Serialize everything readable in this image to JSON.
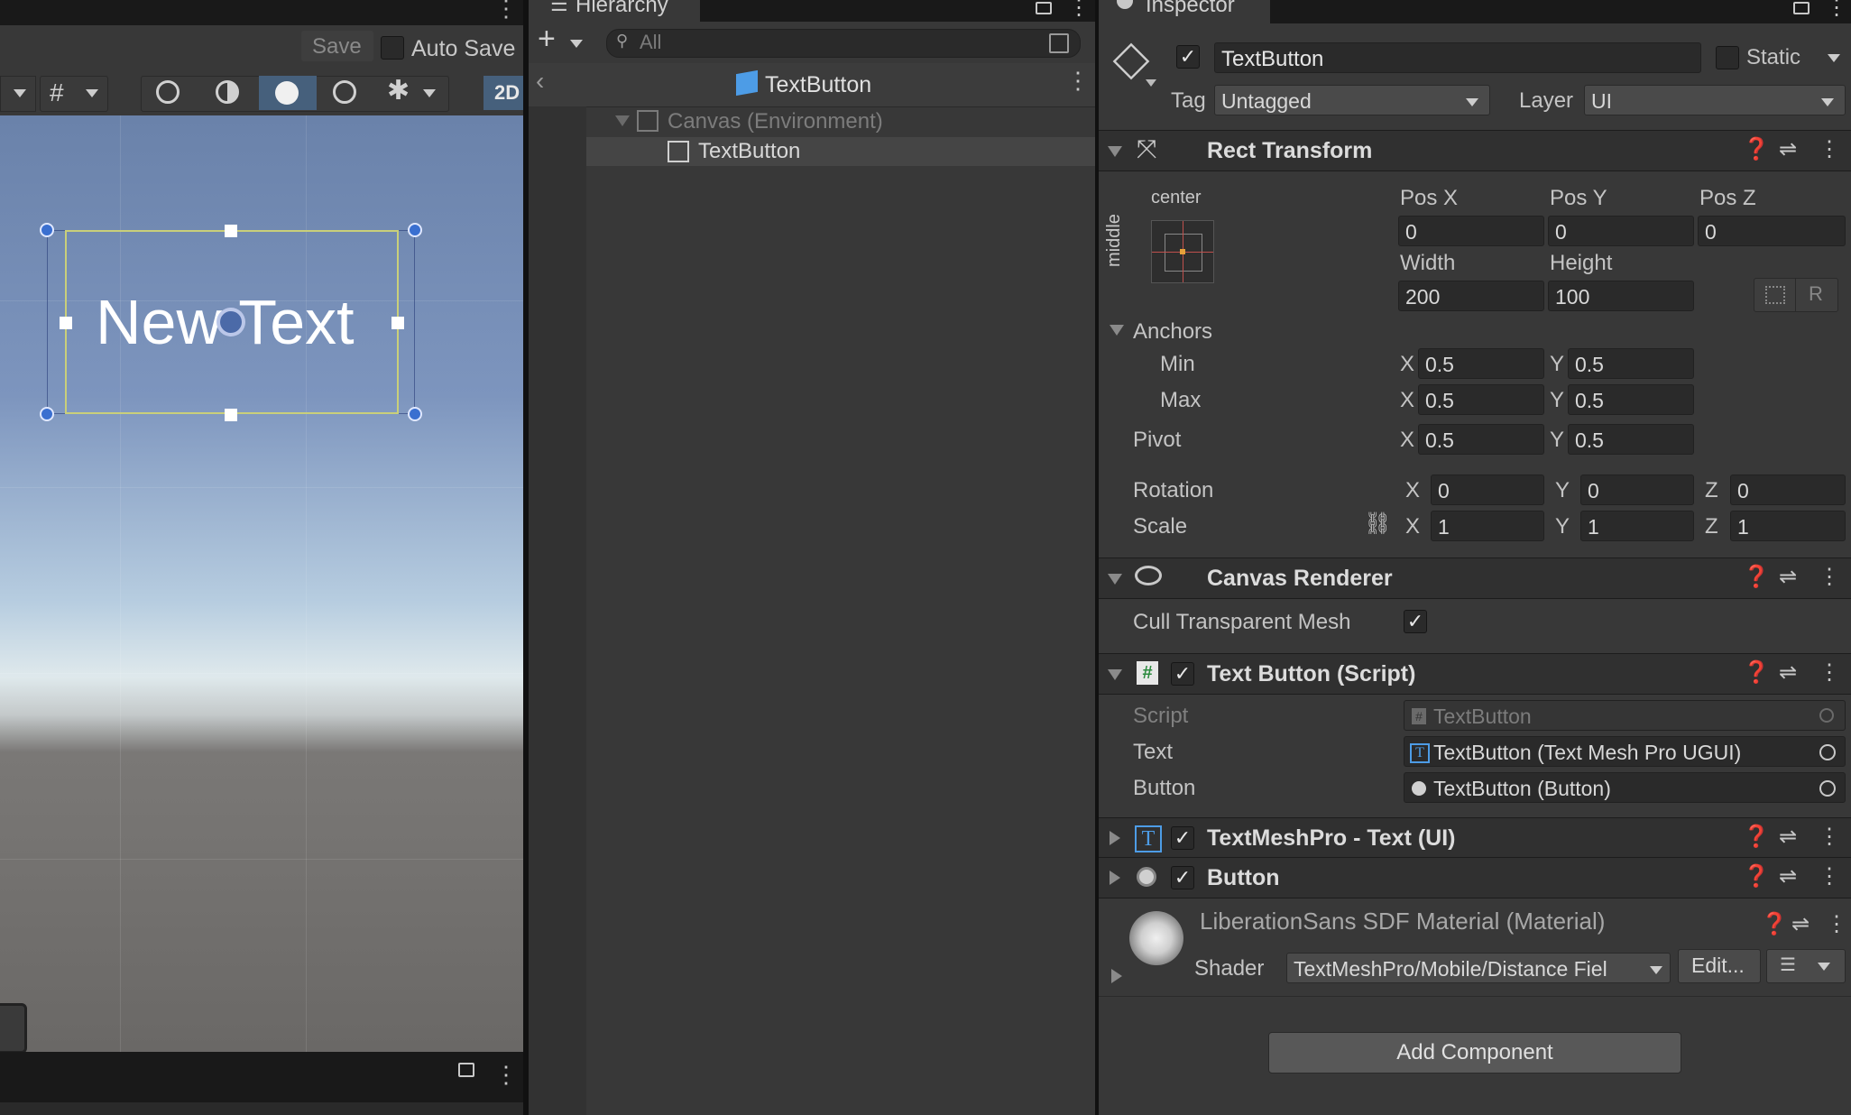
{
  "scene": {
    "save_label": "Save",
    "auto_save_label": "Auto Save",
    "mode_2d": "2D",
    "scene_text": "New Text"
  },
  "hierarchy": {
    "tab_title": "Hierarchy",
    "search_placeholder": "All",
    "breadcrumb_title": "TextButton",
    "items": [
      {
        "label": "Canvas (Environment)"
      },
      {
        "label": "TextButton"
      }
    ]
  },
  "inspector": {
    "tab_title": "Inspector",
    "object_name": "TextButton",
    "static_label": "Static",
    "tag_label": "Tag",
    "tag_value": "Untagged",
    "layer_label": "Layer",
    "layer_value": "UI",
    "rect_transform": {
      "title": "Rect Transform",
      "anchor_preset_top": "center",
      "anchor_preset_side": "middle",
      "posx_label": "Pos X",
      "posx": "0",
      "posy_label": "Pos Y",
      "posy": "0",
      "posz_label": "Pos Z",
      "posz": "0",
      "width_label": "Width",
      "width": "200",
      "height_label": "Height",
      "height": "100",
      "r_label": "R",
      "anchors_label": "Anchors",
      "min_label": "Min",
      "min_x": "0.5",
      "min_y": "0.5",
      "max_label": "Max",
      "max_x": "0.5",
      "max_y": "0.5",
      "pivot_label": "Pivot",
      "pivot_x": "0.5",
      "pivot_y": "0.5",
      "rotation_label": "Rotation",
      "rot_x": "0",
      "rot_y": "0",
      "rot_z": "0",
      "scale_label": "Scale",
      "scale_x": "1",
      "scale_y": "1",
      "scale_z": "1",
      "x": "X",
      "y": "Y",
      "z": "Z"
    },
    "canvas_renderer": {
      "title": "Canvas Renderer",
      "cull_label": "Cull Transparent Mesh"
    },
    "text_button_script": {
      "title": "Text Button (Script)",
      "script_label": "Script",
      "script_value": "TextButton",
      "text_label": "Text",
      "text_value": "TextButton (Text Mesh Pro UGUI)",
      "button_label": "Button",
      "button_value": "TextButton (Button)"
    },
    "tmp_title": "TextMeshPro - Text (UI)",
    "button_title": "Button",
    "material": {
      "title": "LiberationSans SDF Material (Material)",
      "shader_label": "Shader",
      "shader_value": "TextMeshPro/Mobile/Distance Fiel",
      "edit_label": "Edit..."
    },
    "add_component_label": "Add Component"
  },
  "colors": {
    "accent": "#3c8ce6",
    "selection_outline": "#c9cf7a",
    "panel": "#383838"
  }
}
